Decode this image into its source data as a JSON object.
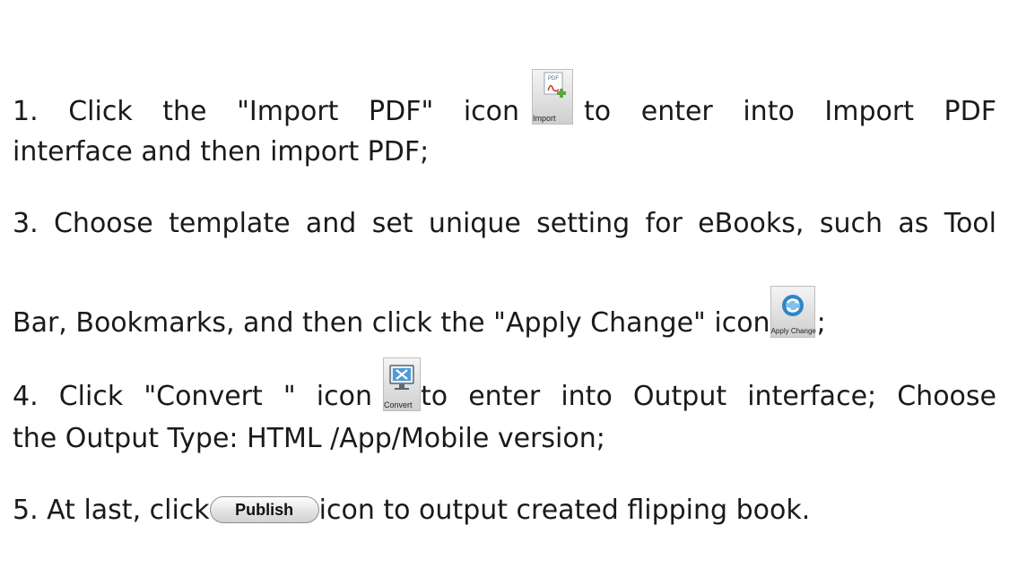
{
  "steps": {
    "step1": {
      "before_icon": "1. Click the \"Import PDF\" icon",
      "icon_name": "import-pdf-icon",
      "icon_label": "Import",
      "icon_badge": "PDF",
      "after_icon": "to enter into Import PDF",
      "line2": "interface and then import PDF;"
    },
    "step3": {
      "line1": "3. Choose template and set unique setting for eBooks, such as Tool",
      "line2_before_icon": "Bar, Bookmarks, and then click the \"Apply Change\" icon",
      "icon_name": "apply-change-icon",
      "icon_label": "Apply Change",
      "after_icon": ";"
    },
    "step4": {
      "before_icon": "4. Click \"Convert \" icon",
      "icon_name": "convert-icon",
      "icon_label": "Convert",
      "after_icon": "to enter into Output interface; Choose",
      "line2": "the Output Type: HTML /App/Mobile version;"
    },
    "step5": {
      "before_button": "5. At last, click",
      "button_label": "Publish",
      "after_button": "icon to output created flipping book."
    }
  },
  "colors": {
    "text": "#1a1a1a",
    "toolbar_gray": "#cfcfcf",
    "accent_blue": "#2f86c8",
    "pdf_red": "#d23a2a",
    "plus_green": "#5aa83a"
  }
}
